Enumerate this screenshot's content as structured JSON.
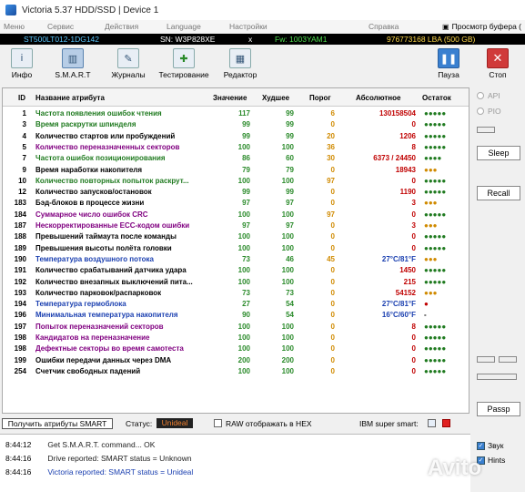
{
  "window": {
    "title": "Victoria 5.37 HDD/SSD | Device 1"
  },
  "menu": {
    "items": [
      "Меню",
      "Сервис",
      "Действия",
      "Language",
      "Настройки",
      "Справка"
    ],
    "right_label": "Просмотр буфера (",
    "right_icon": "copy-icon"
  },
  "device": {
    "model": "ST500LT012-1DG142",
    "serial": "SN: W3P828XE",
    "close": "x",
    "firmware": "Fw: 1003YAM1",
    "capacity": "976773168 LBA (500 GB)"
  },
  "toolbar": {
    "info": "Инфо",
    "smart": "S.M.A.R.T",
    "logs": "Журналы",
    "testing": "Тестирование",
    "editor": "Редактор",
    "pause": "Пауза",
    "stop": "Стоп"
  },
  "table": {
    "headers": {
      "id": "ID",
      "name": "Название атрибута",
      "value": "Значение",
      "worst": "Худшее",
      "threshold": "Порог",
      "raw": "Абсолютное",
      "remaining": "Остаток"
    },
    "rows": [
      {
        "id": "1",
        "name": "Частота появления ошибок чтения",
        "name_color": "#1f7a1f",
        "value": "117",
        "worst": "99",
        "threshold": "6",
        "raw": "130158504",
        "raw_color": "#c00000",
        "dots": "●●●●●",
        "dots_color": "#1f7a1f"
      },
      {
        "id": "3",
        "name": "Время раскрутки шпинделя",
        "name_color": "#1f7a1f",
        "value": "99",
        "worst": "99",
        "threshold": "0",
        "raw": "0",
        "raw_color": "#c00000",
        "dots": "●●●●●",
        "dots_color": "#1f7a1f"
      },
      {
        "id": "4",
        "name": "Количество стартов или пробуждений",
        "name_color": "#000000",
        "value": "99",
        "worst": "99",
        "threshold": "20",
        "raw": "1206",
        "raw_color": "#c00000",
        "dots": "●●●●●",
        "dots_color": "#1f7a1f"
      },
      {
        "id": "5",
        "name": "Количество переназначенных секторов",
        "name_color": "#800080",
        "value": "100",
        "worst": "100",
        "threshold": "36",
        "raw": "8",
        "raw_color": "#c00000",
        "dots": "●●●●●",
        "dots_color": "#1f7a1f"
      },
      {
        "id": "7",
        "name": "Частота ошибок позиционирования",
        "name_color": "#1f7a1f",
        "value": "86",
        "worst": "60",
        "threshold": "30",
        "raw": "6373 / 24450",
        "raw_color": "#c00000",
        "dots": "●●●●",
        "dots_color": "#1f7a1f"
      },
      {
        "id": "9",
        "name": "Время наработки накопителя",
        "name_color": "#000000",
        "value": "79",
        "worst": "79",
        "threshold": "0",
        "raw": "18943",
        "raw_color": "#c00000",
        "dots": "●●●",
        "dots_color": "#d08a00"
      },
      {
        "id": "10",
        "name": "Количество повторных попыток раскрут...",
        "name_color": "#1f7a1f",
        "value": "100",
        "worst": "100",
        "threshold": "97",
        "raw": "0",
        "raw_color": "#c00000",
        "dots": "●●●●●",
        "dots_color": "#1f7a1f"
      },
      {
        "id": "12",
        "name": "Количество запусков/остановок",
        "name_color": "#000000",
        "value": "99",
        "worst": "99",
        "threshold": "0",
        "raw": "1190",
        "raw_color": "#c00000",
        "dots": "●●●●●",
        "dots_color": "#1f7a1f"
      },
      {
        "id": "183",
        "name": "Бэд-блоков в процессе жизни",
        "name_color": "#000000",
        "value": "97",
        "worst": "97",
        "threshold": "0",
        "raw": "3",
        "raw_color": "#c00000",
        "dots": "●●●",
        "dots_color": "#d08a00"
      },
      {
        "id": "184",
        "name": "Суммарное число ошибок CRC",
        "name_color": "#800080",
        "value": "100",
        "worst": "100",
        "threshold": "97",
        "raw": "0",
        "raw_color": "#c00000",
        "dots": "●●●●●",
        "dots_color": "#1f7a1f"
      },
      {
        "id": "187",
        "name": "Нескорректированные ECC-кодом ошибки",
        "name_color": "#800080",
        "value": "97",
        "worst": "97",
        "threshold": "0",
        "raw": "3",
        "raw_color": "#c00000",
        "dots": "●●●",
        "dots_color": "#d08a00"
      },
      {
        "id": "188",
        "name": "Превышений таймаута после команды",
        "name_color": "#000000",
        "value": "100",
        "worst": "100",
        "threshold": "0",
        "raw": "0",
        "raw_color": "#c00000",
        "dots": "●●●●●",
        "dots_color": "#1f7a1f"
      },
      {
        "id": "189",
        "name": "Превышения высоты полёта головки",
        "name_color": "#000000",
        "value": "100",
        "worst": "100",
        "threshold": "0",
        "raw": "0",
        "raw_color": "#c00000",
        "dots": "●●●●●",
        "dots_color": "#1f7a1f"
      },
      {
        "id": "190",
        "name": "Температура воздушного потока",
        "name_color": "#1a3fb0",
        "value": "73",
        "worst": "46",
        "threshold": "45",
        "raw": "27°C/81°F",
        "raw_color": "#1a3fb0",
        "dots": "●●●",
        "dots_color": "#d08a00"
      },
      {
        "id": "191",
        "name": "Количество срабатываний датчика удара",
        "name_color": "#000000",
        "value": "100",
        "worst": "100",
        "threshold": "0",
        "raw": "1450",
        "raw_color": "#c00000",
        "dots": "●●●●●",
        "dots_color": "#1f7a1f"
      },
      {
        "id": "192",
        "name": "Количество внезапных выключений пита...",
        "name_color": "#000000",
        "value": "100",
        "worst": "100",
        "threshold": "0",
        "raw": "215",
        "raw_color": "#c00000",
        "dots": "●●●●●",
        "dots_color": "#1f7a1f"
      },
      {
        "id": "193",
        "name": "Количество парковок/распарковок",
        "name_color": "#000000",
        "value": "73",
        "worst": "73",
        "threshold": "0",
        "raw": "54152",
        "raw_color": "#c00000",
        "dots": "●●●",
        "dots_color": "#d08a00"
      },
      {
        "id": "194",
        "name": "Температура гермоблока",
        "name_color": "#1a3fb0",
        "value": "27",
        "worst": "54",
        "threshold": "0",
        "raw": "27°C/81°F",
        "raw_color": "#1a3fb0",
        "dots": "●",
        "dots_color": "#c00000"
      },
      {
        "id": "196",
        "name": "Минимальная температура накопителя",
        "name_color": "#1a3fb0",
        "value": "90",
        "worst": "54",
        "threshold": "0",
        "raw": "16°C/60°F",
        "raw_color": "#1a3fb0",
        "dots": "-",
        "dots_color": "#000000"
      },
      {
        "id": "197",
        "name": "Попыток переназначений секторов",
        "name_color": "#800080",
        "value": "100",
        "worst": "100",
        "threshold": "0",
        "raw": "8",
        "raw_color": "#c00000",
        "dots": "●●●●●",
        "dots_color": "#1f7a1f"
      },
      {
        "id": "198",
        "name": "Кандидатов на переназначение",
        "name_color": "#800080",
        "value": "100",
        "worst": "100",
        "threshold": "0",
        "raw": "0",
        "raw_color": "#c00000",
        "dots": "●●●●●",
        "dots_color": "#1f7a1f"
      },
      {
        "id": "198",
        "name": "Дефектные секторы во время самотеста",
        "name_color": "#800080",
        "value": "100",
        "worst": "100",
        "threshold": "0",
        "raw": "0",
        "raw_color": "#c00000",
        "dots": "●●●●●",
        "dots_color": "#1f7a1f"
      },
      {
        "id": "199",
        "name": "Ошибки передачи данных через DMA",
        "name_color": "#000000",
        "value": "200",
        "worst": "200",
        "threshold": "0",
        "raw": "0",
        "raw_color": "#c00000",
        "dots": "●●●●●",
        "dots_color": "#1f7a1f"
      },
      {
        "id": "254",
        "name": "Счетчик свободных падений",
        "name_color": "#000000",
        "value": "100",
        "worst": "100",
        "threshold": "0",
        "raw": "0",
        "raw_color": "#c00000",
        "dots": "●●●●●",
        "dots_color": "#1f7a1f"
      }
    ]
  },
  "right_panel": {
    "api": "API",
    "pio": "PIO",
    "sleep": "Sleep",
    "recall": "Recall",
    "passp": "Passp"
  },
  "bottom": {
    "get_button": "Получить атрибуты SMART",
    "status_label": "Статус:",
    "status_value": "Unideal",
    "raw_hex": "RAW отображать в HEX",
    "ibm": "IBM super smart:"
  },
  "log": [
    {
      "time": "8:44:12",
      "text": "Get S.M.A.R.T. command... OK",
      "color": "#222222"
    },
    {
      "time": "8:44:16",
      "text": "Drive reported: SMART status = Unknown",
      "color": "#222222"
    },
    {
      "time": "8:44:16",
      "text": "Victoria reported: SMART status = Unideal",
      "color": "#1a3fb0"
    }
  ],
  "log_options": {
    "sound": "Звук",
    "hints": "Hints"
  },
  "watermark": "Avito"
}
